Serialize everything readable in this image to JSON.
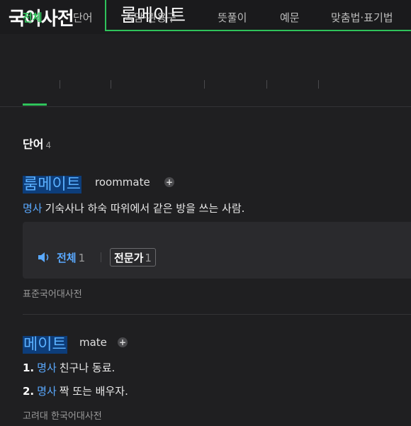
{
  "header": {
    "logo": "국어사전",
    "search_value": "룸메이트"
  },
  "tabs": [
    {
      "label": "전체",
      "active": true
    },
    {
      "label": "단어"
    },
    {
      "label": "속담·관용구"
    },
    {
      "label": "뜻풀이"
    },
    {
      "label": "예문"
    },
    {
      "label": "맞춤법·표기법"
    }
  ],
  "section": {
    "title": "단어",
    "count": "4"
  },
  "entries": [
    {
      "word": "룸메이트",
      "original": "roommate",
      "definitions": [
        {
          "pos": "명사",
          "text": "기숙사나 하숙 따위에서 같은 방을 쓰는 사람."
        }
      ],
      "audio": {
        "all_label": "전체",
        "all_count": "1",
        "expert_label": "전문가",
        "expert_count": "1"
      },
      "source": "표준국어대사전"
    },
    {
      "word": "메이트",
      "original": "mate",
      "definitions": [
        {
          "num": "1.",
          "pos": "명사",
          "text": "친구나 동료."
        },
        {
          "num": "2.",
          "pos": "명사",
          "text": "짝 또는 배우자."
        }
      ],
      "source": "고려대 한국어대사전"
    }
  ],
  "colors": {
    "accent_green": "#2fc35b",
    "link_blue": "#5aa9ff",
    "highlight_bg": "#0d3d7a",
    "background": "#1f1f21"
  }
}
